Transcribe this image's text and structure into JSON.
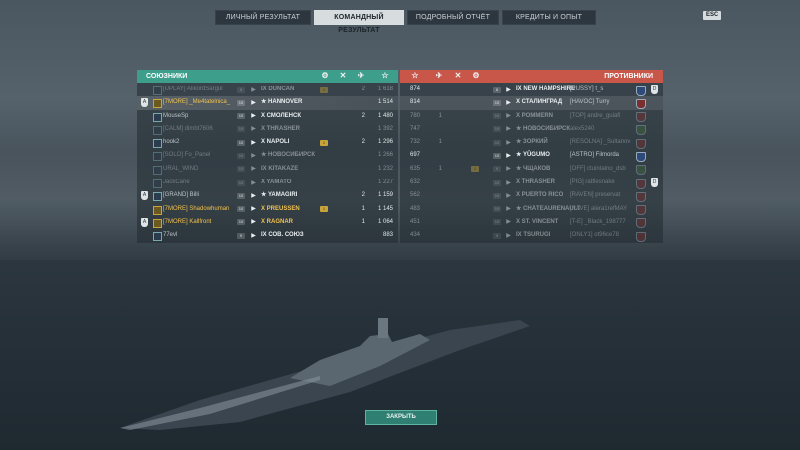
{
  "tabs": [
    {
      "label": "ЛИЧНЫЙ РЕЗУЛЬТАТ",
      "active": false
    },
    {
      "label": "КОМАНДНЫЙ РЕЗУЛЬТАТ",
      "active": true
    },
    {
      "label": "ПОДРОБНЫЙ ОТЧЁТ",
      "active": false
    },
    {
      "label": "КРЕДИТЫ И ОПЫТ",
      "active": false
    }
  ],
  "esc_label": "ESC",
  "allies": {
    "title": "СОЮЗНИКИ",
    "color": "#3d9e8c",
    "rows": [
      {
        "player": "[UPLAY] AlikordSargul",
        "level": "8",
        "ship": "IX DUNCAN",
        "achv": "1",
        "frags": "2",
        "xp": "1 618",
        "dead": true
      },
      {
        "player": "[7MORE] _Me4tatelnica_",
        "level": "10",
        "ship": "★ HANNOVER",
        "achv": "",
        "frags": "",
        "xp": "1 514",
        "me": true
      },
      {
        "player": "MouseSp",
        "level": "10",
        "ship": "X СМОЛЕНСК",
        "achv": "",
        "frags": "2",
        "xp": "1 480"
      },
      {
        "player": "[CALM] dimbt7606",
        "level": "10",
        "ship": "X THRASHER",
        "achv": "",
        "frags": "",
        "xp": "1 392",
        "dead": true
      },
      {
        "player": "hook2",
        "level": "10",
        "ship": "X NAPOLI",
        "achv": "1",
        "frags": "2",
        "xp": "1 296"
      },
      {
        "player": "[SOLO] Fo_Panel",
        "level": "10",
        "ship": "★ НОВОСИБИРСК",
        "achv": "",
        "frags": "",
        "xp": "1 266",
        "dead": true
      },
      {
        "player": "URAL_WIND",
        "level": "10",
        "ship": "IX KITAKAZE",
        "achv": "",
        "frags": "",
        "xp": "1 232",
        "dead": true
      },
      {
        "player": "JackCane",
        "level": "10",
        "ship": "X YAMATO",
        "achv": "",
        "frags": "",
        "xp": "1 227",
        "dead": true
      },
      {
        "player": "[GRAND] Billi",
        "level": "10",
        "ship": "★ YAMAGIRI",
        "achv": "",
        "frags": "2",
        "xp": "1 159"
      },
      {
        "player": "[7MORE] Shadowhuman",
        "level": "10",
        "ship": "X PREUSSEN",
        "achv": "1",
        "frags": "1",
        "xp": "1 145",
        "gold": true
      },
      {
        "player": "[7MORE] Kallfront",
        "level": "10",
        "ship": "X RAGNAR",
        "achv": "",
        "frags": "1",
        "xp": "1 064",
        "gold": true
      },
      {
        "player": "77evl",
        "level": "9",
        "ship": "IX СОВ. СОЮЗ",
        "achv": "",
        "frags": "",
        "xp": "883"
      }
    ]
  },
  "enemies": {
    "title": "ПРОТИВНИКИ",
    "color": "#c8574a",
    "rows": [
      {
        "xp": "874",
        "frags": "",
        "achv": "",
        "level": "8",
        "ship": "IX NEW HAMPSHIRE",
        "player": "[PUSSY] t_s"
      },
      {
        "xp": "814",
        "frags": "",
        "achv": "",
        "level": "10",
        "ship": "X СТАЛИНГРАД",
        "player": "[HAVOC] Turry",
        "me": true
      },
      {
        "xp": "780",
        "frags": "1",
        "achv": "",
        "level": "10",
        "ship": "X POMMERN",
        "player": "[TOP] andre_guiafi",
        "dead": true
      },
      {
        "xp": "747",
        "frags": "",
        "achv": "",
        "level": "10",
        "ship": "★ НОВОСИБИРСК",
        "player": "alex5240",
        "dead": true
      },
      {
        "xp": "732",
        "frags": "1",
        "achv": "",
        "level": "10",
        "ship": "★ ЗОРКИЙ",
        "player": "[RESOLNA] _Sultanov",
        "dead": true
      },
      {
        "xp": "697",
        "frags": "",
        "achv": "",
        "level": "10",
        "ship": "★ YŪGUMO",
        "player": "[ASTRO] Filmorda"
      },
      {
        "xp": "635",
        "frags": "1",
        "achv": "1",
        "level": "9",
        "ship": "★ ЧЩАКОВ",
        "player": "[OFF] ctuintaino_dsb",
        "dead": true
      },
      {
        "xp": "632",
        "frags": "",
        "achv": "",
        "level": "10",
        "ship": "X THRASHER",
        "player": "[PIG] rattlesnake",
        "dead": true
      },
      {
        "xp": "562",
        "frags": "",
        "achv": "",
        "level": "10",
        "ship": "X PUERTO RICO",
        "player": "[RAVEN] preservat",
        "dead": true
      },
      {
        "xp": "483",
        "frags": "",
        "achv": "",
        "level": "10",
        "ship": "★ CHÂTEAURENAULT",
        "player": "[RAVE] alera1refMAY",
        "dead": true
      },
      {
        "xp": "451",
        "frags": "",
        "achv": "",
        "level": "10",
        "ship": "X ST. VINCENT",
        "player": "[T-E] _Black_198777",
        "dead": true
      },
      {
        "xp": "434",
        "frags": "",
        "achv": "",
        "level": "9",
        "ship": "IX TSURUGI",
        "player": "[ONLY1] ot96ce78",
        "dead": true
      }
    ]
  },
  "close_label": "ЗАКРЫТЬ"
}
